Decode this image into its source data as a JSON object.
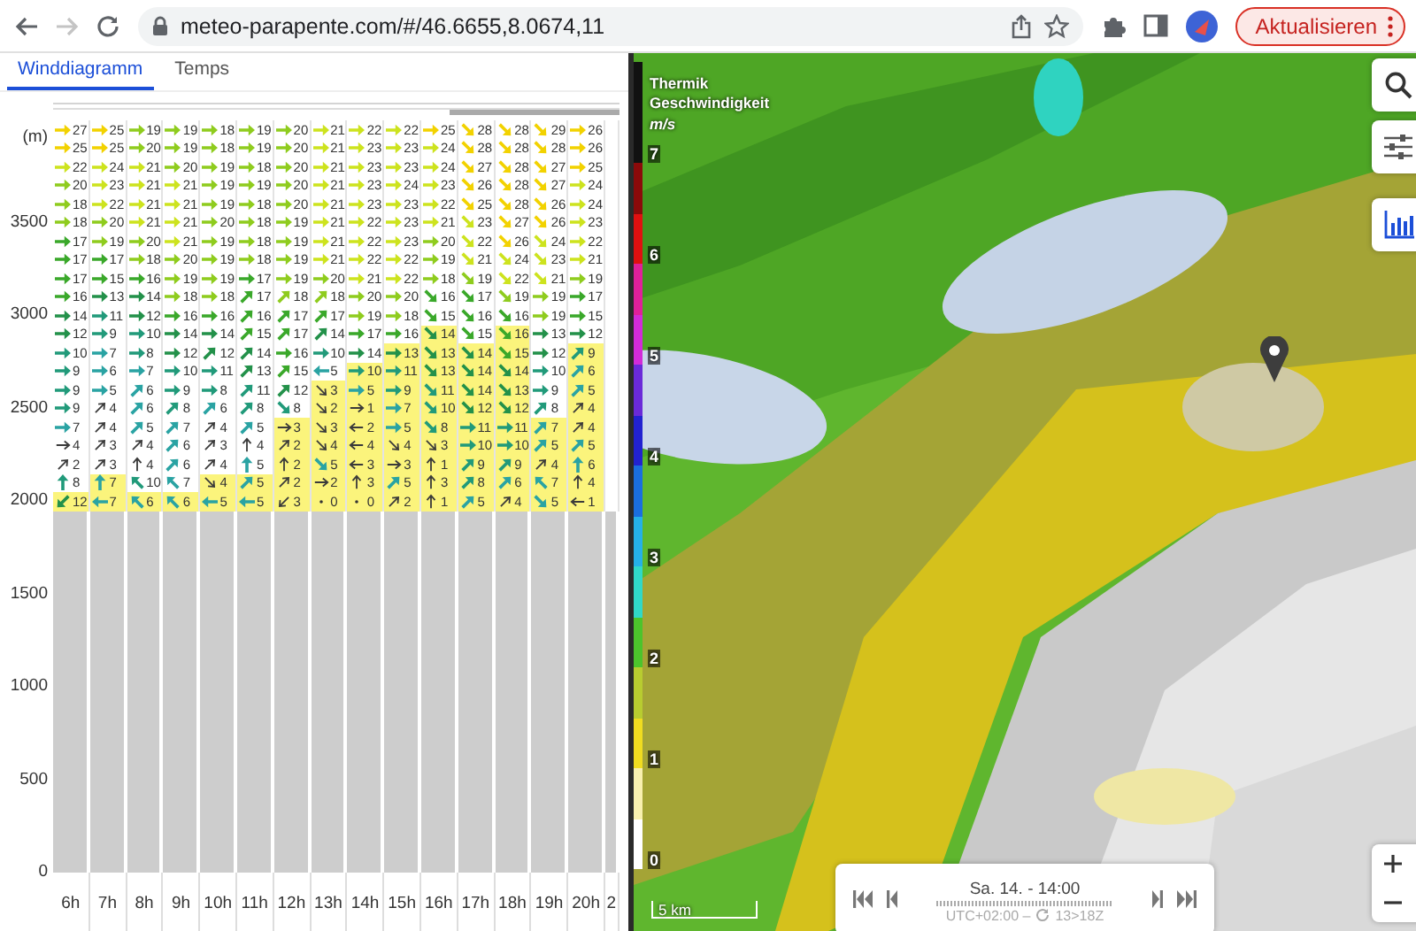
{
  "browser": {
    "url": "meteo-parapente.com/#/46.6655,8.0674,11",
    "update_button": "Aktualisieren",
    "forward_disabled": true
  },
  "tabs": [
    {
      "label": "Winddiagramm",
      "selected": true
    },
    {
      "label": "Temps",
      "selected": false
    }
  ],
  "wind_diagram": {
    "y_unit": "(m)",
    "y_ticks": [
      "3500",
      "3000",
      "2500",
      "2000",
      "1500",
      "1000",
      "500",
      "0"
    ],
    "hours": [
      "6h",
      "7h",
      "8h",
      "9h",
      "10h",
      "11h",
      "12h",
      "13h",
      "14h",
      "15h",
      "16h",
      "17h",
      "18h",
      "19h",
      "20h",
      "2"
    ],
    "rows": [
      {
        "cells": [
          {
            "speed": "27",
            "kind": "east",
            "thermal": false
          },
          {
            "speed": "25",
            "kind": "east",
            "thermal": false
          },
          {
            "speed": "19",
            "kind": "east",
            "thermal": false
          },
          {
            "speed": "19",
            "kind": "east",
            "thermal": false
          },
          {
            "speed": "18",
            "kind": "east",
            "thermal": false
          },
          {
            "speed": "19",
            "kind": "east",
            "thermal": false
          },
          {
            "speed": "20",
            "kind": "east",
            "thermal": false
          },
          {
            "speed": "21",
            "kind": "east",
            "thermal": false
          },
          {
            "speed": "22",
            "kind": "east",
            "thermal": false
          },
          {
            "speed": "22",
            "kind": "east",
            "thermal": false
          },
          {
            "speed": "25",
            "kind": "east",
            "thermal": false
          },
          {
            "speed": "28",
            "kind": "southeast",
            "thermal": false
          },
          {
            "speed": "28",
            "kind": "southeast",
            "thermal": false
          },
          {
            "speed": "29",
            "kind": "southeast",
            "thermal": false
          },
          {
            "speed": "26",
            "kind": "east",
            "thermal": false
          }
        ]
      },
      {
        "cells": [
          {
            "speed": "25",
            "kind": "east",
            "thermal": false
          },
          {
            "speed": "25",
            "kind": "east",
            "thermal": false
          },
          {
            "speed": "20",
            "kind": "east",
            "thermal": false
          },
          {
            "speed": "19",
            "kind": "east",
            "thermal": false
          },
          {
            "speed": "18",
            "kind": "east",
            "thermal": false
          },
          {
            "speed": "19",
            "kind": "east",
            "thermal": false
          },
          {
            "speed": "20",
            "kind": "east",
            "thermal": false
          },
          {
            "speed": "21",
            "kind": "east",
            "thermal": false
          },
          {
            "speed": "23",
            "kind": "east",
            "thermal": false
          },
          {
            "speed": "23",
            "kind": "east",
            "thermal": false
          },
          {
            "speed": "24",
            "kind": "east",
            "thermal": false
          },
          {
            "speed": "28",
            "kind": "southeast",
            "thermal": false
          },
          {
            "speed": "28",
            "kind": "southeast",
            "thermal": false
          },
          {
            "speed": "28",
            "kind": "southeast",
            "thermal": false
          },
          {
            "speed": "26",
            "kind": "east",
            "thermal": false
          }
        ]
      },
      {
        "cells": [
          {
            "speed": "22",
            "kind": "east",
            "thermal": false
          },
          {
            "speed": "24",
            "kind": "east",
            "thermal": false
          },
          {
            "speed": "21",
            "kind": "east",
            "thermal": false
          },
          {
            "speed": "20",
            "kind": "east",
            "thermal": false
          },
          {
            "speed": "19",
            "kind": "east",
            "thermal": false
          },
          {
            "speed": "18",
            "kind": "east",
            "thermal": false
          },
          {
            "speed": "20",
            "kind": "east",
            "thermal": false
          },
          {
            "speed": "21",
            "kind": "east",
            "thermal": false
          },
          {
            "speed": "23",
            "kind": "east",
            "thermal": false
          },
          {
            "speed": "23",
            "kind": "east",
            "thermal": false
          },
          {
            "speed": "24",
            "kind": "east",
            "thermal": false
          },
          {
            "speed": "27",
            "kind": "southeast",
            "thermal": false
          },
          {
            "speed": "28",
            "kind": "southeast",
            "thermal": false
          },
          {
            "speed": "27",
            "kind": "southeast",
            "thermal": false
          },
          {
            "speed": "25",
            "kind": "east",
            "thermal": false
          }
        ]
      },
      {
        "cells": [
          {
            "speed": "20",
            "kind": "east",
            "thermal": false
          },
          {
            "speed": "23",
            "kind": "east",
            "thermal": false
          },
          {
            "speed": "21",
            "kind": "east",
            "thermal": false
          },
          {
            "speed": "21",
            "kind": "east",
            "thermal": false
          },
          {
            "speed": "19",
            "kind": "east",
            "thermal": false
          },
          {
            "speed": "19",
            "kind": "east",
            "thermal": false
          },
          {
            "speed": "20",
            "kind": "east",
            "thermal": false
          },
          {
            "speed": "21",
            "kind": "east",
            "thermal": false
          },
          {
            "speed": "23",
            "kind": "east",
            "thermal": false
          },
          {
            "speed": "24",
            "kind": "east",
            "thermal": false
          },
          {
            "speed": "23",
            "kind": "east",
            "thermal": false
          },
          {
            "speed": "26",
            "kind": "southeast",
            "thermal": false
          },
          {
            "speed": "28",
            "kind": "southeast",
            "thermal": false
          },
          {
            "speed": "27",
            "kind": "southeast",
            "thermal": false
          },
          {
            "speed": "24",
            "kind": "east",
            "thermal": false
          }
        ]
      },
      {
        "cells": [
          {
            "speed": "18",
            "kind": "east",
            "thermal": false
          },
          {
            "speed": "22",
            "kind": "east",
            "thermal": false
          },
          {
            "speed": "21",
            "kind": "east",
            "thermal": false
          },
          {
            "speed": "21",
            "kind": "east",
            "thermal": false
          },
          {
            "speed": "19",
            "kind": "east",
            "thermal": false
          },
          {
            "speed": "18",
            "kind": "east",
            "thermal": false
          },
          {
            "speed": "20",
            "kind": "east",
            "thermal": false
          },
          {
            "speed": "21",
            "kind": "east",
            "thermal": false
          },
          {
            "speed": "23",
            "kind": "east",
            "thermal": false
          },
          {
            "speed": "23",
            "kind": "east",
            "thermal": false
          },
          {
            "speed": "22",
            "kind": "east",
            "thermal": false
          },
          {
            "speed": "25",
            "kind": "southeast",
            "thermal": false
          },
          {
            "speed": "28",
            "kind": "southeast",
            "thermal": false
          },
          {
            "speed": "26",
            "kind": "southeast",
            "thermal": false
          },
          {
            "speed": "24",
            "kind": "east",
            "thermal": false
          }
        ]
      },
      {
        "cells": [
          {
            "speed": "18",
            "kind": "east",
            "thermal": false
          },
          {
            "speed": "20",
            "kind": "east",
            "thermal": false
          },
          {
            "speed": "21",
            "kind": "east",
            "thermal": false
          },
          {
            "speed": "21",
            "kind": "east",
            "thermal": false
          },
          {
            "speed": "20",
            "kind": "east",
            "thermal": false
          },
          {
            "speed": "18",
            "kind": "east",
            "thermal": false
          },
          {
            "speed": "19",
            "kind": "east",
            "thermal": false
          },
          {
            "speed": "21",
            "kind": "east",
            "thermal": false
          },
          {
            "speed": "22",
            "kind": "east",
            "thermal": false
          },
          {
            "speed": "23",
            "kind": "east",
            "thermal": false
          },
          {
            "speed": "21",
            "kind": "east",
            "thermal": false
          },
          {
            "speed": "23",
            "kind": "southeast",
            "thermal": false
          },
          {
            "speed": "27",
            "kind": "southeast",
            "thermal": false
          },
          {
            "speed": "26",
            "kind": "southeast",
            "thermal": false
          },
          {
            "speed": "23",
            "kind": "east",
            "thermal": false
          }
        ]
      },
      {
        "cells": [
          {
            "speed": "17",
            "kind": "east",
            "thermal": false
          },
          {
            "speed": "19",
            "kind": "east",
            "thermal": false
          },
          {
            "speed": "20",
            "kind": "east",
            "thermal": false
          },
          {
            "speed": "21",
            "kind": "east",
            "thermal": false
          },
          {
            "speed": "19",
            "kind": "east",
            "thermal": false
          },
          {
            "speed": "18",
            "kind": "east",
            "thermal": false
          },
          {
            "speed": "19",
            "kind": "east",
            "thermal": false
          },
          {
            "speed": "21",
            "kind": "east",
            "thermal": false
          },
          {
            "speed": "22",
            "kind": "east",
            "thermal": false
          },
          {
            "speed": "23",
            "kind": "east",
            "thermal": false
          },
          {
            "speed": "20",
            "kind": "east",
            "thermal": false
          },
          {
            "speed": "22",
            "kind": "southeast",
            "thermal": false
          },
          {
            "speed": "26",
            "kind": "southeast",
            "thermal": false
          },
          {
            "speed": "24",
            "kind": "southeast",
            "thermal": false
          },
          {
            "speed": "22",
            "kind": "east",
            "thermal": false
          }
        ]
      },
      {
        "cells": [
          {
            "speed": "17",
            "kind": "east",
            "thermal": false
          },
          {
            "speed": "17",
            "kind": "east",
            "thermal": false
          },
          {
            "speed": "18",
            "kind": "east",
            "thermal": false
          },
          {
            "speed": "20",
            "kind": "east",
            "thermal": false
          },
          {
            "speed": "19",
            "kind": "east",
            "thermal": false
          },
          {
            "speed": "18",
            "kind": "east",
            "thermal": false
          },
          {
            "speed": "19",
            "kind": "east",
            "thermal": false
          },
          {
            "speed": "21",
            "kind": "east",
            "thermal": false
          },
          {
            "speed": "22",
            "kind": "east",
            "thermal": false
          },
          {
            "speed": "22",
            "kind": "east",
            "thermal": false
          },
          {
            "speed": "19",
            "kind": "east",
            "thermal": false
          },
          {
            "speed": "21",
            "kind": "southeast",
            "thermal": false
          },
          {
            "speed": "24",
            "kind": "southeast",
            "thermal": false
          },
          {
            "speed": "23",
            "kind": "southeast",
            "thermal": false
          },
          {
            "speed": "21",
            "kind": "east",
            "thermal": false
          }
        ]
      },
      {
        "cells": [
          {
            "speed": "17",
            "kind": "east",
            "thermal": false
          },
          {
            "speed": "15",
            "kind": "east",
            "thermal": false
          },
          {
            "speed": "16",
            "kind": "east",
            "thermal": false
          },
          {
            "speed": "19",
            "kind": "east",
            "thermal": false
          },
          {
            "speed": "19",
            "kind": "east",
            "thermal": false
          },
          {
            "speed": "17",
            "kind": "east",
            "thermal": false
          },
          {
            "speed": "19",
            "kind": "east",
            "thermal": false
          },
          {
            "speed": "20",
            "kind": "east",
            "thermal": false
          },
          {
            "speed": "21",
            "kind": "east",
            "thermal": false
          },
          {
            "speed": "22",
            "kind": "east",
            "thermal": false
          },
          {
            "speed": "18",
            "kind": "east",
            "thermal": false
          },
          {
            "speed": "19",
            "kind": "southeast",
            "thermal": false
          },
          {
            "speed": "22",
            "kind": "southeast",
            "thermal": false
          },
          {
            "speed": "21",
            "kind": "southeast",
            "thermal": false
          },
          {
            "speed": "19",
            "kind": "east",
            "thermal": false
          }
        ]
      },
      {
        "cells": [
          {
            "speed": "16",
            "kind": "east",
            "thermal": false
          },
          {
            "speed": "13",
            "kind": "east",
            "thermal": false
          },
          {
            "speed": "14",
            "kind": "east",
            "thermal": false
          },
          {
            "speed": "18",
            "kind": "east",
            "thermal": false
          },
          {
            "speed": "18",
            "kind": "east",
            "thermal": false
          },
          {
            "speed": "17",
            "kind": "northeast",
            "thermal": false
          },
          {
            "speed": "18",
            "kind": "northeast",
            "thermal": false
          },
          {
            "speed": "18",
            "kind": "northeast",
            "thermal": false
          },
          {
            "speed": "20",
            "kind": "east",
            "thermal": false
          },
          {
            "speed": "20",
            "kind": "east",
            "thermal": false
          },
          {
            "speed": "16",
            "kind": "southeast",
            "thermal": false
          },
          {
            "speed": "17",
            "kind": "southeast",
            "thermal": false
          },
          {
            "speed": "19",
            "kind": "southeast",
            "thermal": false
          },
          {
            "speed": "19",
            "kind": "east",
            "thermal": false
          },
          {
            "speed": "17",
            "kind": "east",
            "thermal": false
          }
        ]
      },
      {
        "cells": [
          {
            "speed": "14",
            "kind": "east",
            "thermal": false
          },
          {
            "speed": "11",
            "kind": "east",
            "thermal": false
          },
          {
            "speed": "12",
            "kind": "east",
            "thermal": false
          },
          {
            "speed": "16",
            "kind": "east",
            "thermal": false
          },
          {
            "speed": "16",
            "kind": "east",
            "thermal": false
          },
          {
            "speed": "16",
            "kind": "northeast",
            "thermal": false
          },
          {
            "speed": "17",
            "kind": "northeast",
            "thermal": false
          },
          {
            "speed": "17",
            "kind": "northeast",
            "thermal": false
          },
          {
            "speed": "19",
            "kind": "east",
            "thermal": false
          },
          {
            "speed": "18",
            "kind": "east",
            "thermal": false
          },
          {
            "speed": "15",
            "kind": "southeast",
            "thermal": false
          },
          {
            "speed": "16",
            "kind": "southeast",
            "thermal": false
          },
          {
            "speed": "16",
            "kind": "southeast",
            "thermal": false
          },
          {
            "speed": "19",
            "kind": "east",
            "thermal": false
          },
          {
            "speed": "15",
            "kind": "east",
            "thermal": false
          }
        ]
      },
      {
        "cells": [
          {
            "speed": "12",
            "kind": "east",
            "thermal": false
          },
          {
            "speed": "9",
            "kind": "east",
            "thermal": false
          },
          {
            "speed": "10",
            "kind": "east",
            "thermal": false
          },
          {
            "speed": "14",
            "kind": "east",
            "thermal": false
          },
          {
            "speed": "14",
            "kind": "east",
            "thermal": false
          },
          {
            "speed": "15",
            "kind": "northeast",
            "thermal": false
          },
          {
            "speed": "17",
            "kind": "northeast",
            "thermal": false
          },
          {
            "speed": "14",
            "kind": "northeast",
            "thermal": false
          },
          {
            "speed": "17",
            "kind": "east",
            "thermal": false
          },
          {
            "speed": "16",
            "kind": "east",
            "thermal": false
          },
          {
            "speed": "14",
            "kind": "southeast",
            "thermal": true
          },
          {
            "speed": "15",
            "kind": "southeast",
            "thermal": false
          },
          {
            "speed": "16",
            "kind": "southeast",
            "thermal": true
          },
          {
            "speed": "13",
            "kind": "east",
            "thermal": false
          },
          {
            "speed": "12",
            "kind": "east",
            "thermal": false
          }
        ]
      },
      {
        "cells": [
          {
            "speed": "10",
            "kind": "east",
            "thermal": false
          },
          {
            "speed": "7",
            "kind": "east",
            "thermal": false
          },
          {
            "speed": "8",
            "kind": "east",
            "thermal": false
          },
          {
            "speed": "12",
            "kind": "east",
            "thermal": false
          },
          {
            "speed": "12",
            "kind": "northeast",
            "thermal": false
          },
          {
            "speed": "14",
            "kind": "northeast",
            "thermal": false
          },
          {
            "speed": "16",
            "kind": "east",
            "thermal": false
          },
          {
            "speed": "10",
            "kind": "east",
            "thermal": false
          },
          {
            "speed": "14",
            "kind": "east",
            "thermal": false
          },
          {
            "speed": "13",
            "kind": "east",
            "thermal": true
          },
          {
            "speed": "13",
            "kind": "southeast",
            "thermal": true
          },
          {
            "speed": "14",
            "kind": "southeast",
            "thermal": true
          },
          {
            "speed": "15",
            "kind": "southeast",
            "thermal": true
          },
          {
            "speed": "12",
            "kind": "east",
            "thermal": false
          },
          {
            "speed": "9",
            "kind": "northeast",
            "thermal": true
          }
        ]
      },
      {
        "cells": [
          {
            "speed": "9",
            "kind": "east",
            "thermal": false
          },
          {
            "speed": "6",
            "kind": "east",
            "thermal": false
          },
          {
            "speed": "7",
            "kind": "east",
            "thermal": false
          },
          {
            "speed": "10",
            "kind": "east",
            "thermal": false
          },
          {
            "speed": "11",
            "kind": "east",
            "thermal": false
          },
          {
            "speed": "13",
            "kind": "northeast",
            "thermal": false
          },
          {
            "speed": "15",
            "kind": "northeast",
            "thermal": false
          },
          {
            "speed": "5",
            "kind": "west",
            "thermal": false
          },
          {
            "speed": "10",
            "kind": "east",
            "thermal": true
          },
          {
            "speed": "11",
            "kind": "east",
            "thermal": true
          },
          {
            "speed": "13",
            "kind": "southeast",
            "thermal": true
          },
          {
            "speed": "14",
            "kind": "southeast",
            "thermal": true
          },
          {
            "speed": "14",
            "kind": "southeast",
            "thermal": true
          },
          {
            "speed": "10",
            "kind": "east",
            "thermal": false
          },
          {
            "speed": "6",
            "kind": "northeast",
            "thermal": true
          }
        ]
      },
      {
        "cells": [
          {
            "speed": "9",
            "kind": "east",
            "thermal": false
          },
          {
            "speed": "5",
            "kind": "east",
            "thermal": false
          },
          {
            "speed": "6",
            "kind": "northeast",
            "thermal": false
          },
          {
            "speed": "9",
            "kind": "east",
            "thermal": false
          },
          {
            "speed": "8",
            "kind": "east",
            "thermal": false
          },
          {
            "speed": "11",
            "kind": "northeast",
            "thermal": false
          },
          {
            "speed": "12",
            "kind": "northeast",
            "thermal": false
          },
          {
            "speed": "3",
            "kind": "southeast",
            "thermal": true
          },
          {
            "speed": "5",
            "kind": "east",
            "thermal": true
          },
          {
            "speed": "9",
            "kind": "east",
            "thermal": true
          },
          {
            "speed": "11",
            "kind": "southeast",
            "thermal": true
          },
          {
            "speed": "14",
            "kind": "southeast",
            "thermal": true
          },
          {
            "speed": "13",
            "kind": "southeast",
            "thermal": true
          },
          {
            "speed": "9",
            "kind": "east",
            "thermal": false
          },
          {
            "speed": "5",
            "kind": "northeast",
            "thermal": true
          }
        ]
      },
      {
        "cells": [
          {
            "speed": "9",
            "kind": "east",
            "thermal": false
          },
          {
            "speed": "4",
            "kind": "northeast",
            "thermal": false
          },
          {
            "speed": "6",
            "kind": "northeast",
            "thermal": false
          },
          {
            "speed": "8",
            "kind": "northeast",
            "thermal": false
          },
          {
            "speed": "6",
            "kind": "northeast",
            "thermal": false
          },
          {
            "speed": "8",
            "kind": "northeast",
            "thermal": false
          },
          {
            "speed": "8",
            "kind": "southeast",
            "thermal": false
          },
          {
            "speed": "2",
            "kind": "southeast",
            "thermal": true
          },
          {
            "speed": "1",
            "kind": "east",
            "thermal": true
          },
          {
            "speed": "7",
            "kind": "east",
            "thermal": true
          },
          {
            "speed": "10",
            "kind": "southeast",
            "thermal": true
          },
          {
            "speed": "12",
            "kind": "southeast",
            "thermal": true
          },
          {
            "speed": "12",
            "kind": "southeast",
            "thermal": true
          },
          {
            "speed": "8",
            "kind": "northeast",
            "thermal": false
          },
          {
            "speed": "4",
            "kind": "northeast",
            "thermal": true
          }
        ]
      },
      {
        "cells": [
          {
            "speed": "7",
            "kind": "east",
            "thermal": false
          },
          {
            "speed": "4",
            "kind": "northeast",
            "thermal": false
          },
          {
            "speed": "5",
            "kind": "northeast",
            "thermal": false
          },
          {
            "speed": "7",
            "kind": "northeast",
            "thermal": false
          },
          {
            "speed": "4",
            "kind": "northeast",
            "thermal": false
          },
          {
            "speed": "5",
            "kind": "northeast",
            "thermal": false
          },
          {
            "speed": "3",
            "kind": "east",
            "thermal": true
          },
          {
            "speed": "3",
            "kind": "southeast",
            "thermal": true
          },
          {
            "speed": "2",
            "kind": "west",
            "thermal": true
          },
          {
            "speed": "5",
            "kind": "east",
            "thermal": true
          },
          {
            "speed": "8",
            "kind": "southeast",
            "thermal": true
          },
          {
            "speed": "11",
            "kind": "east",
            "thermal": true
          },
          {
            "speed": "11",
            "kind": "east",
            "thermal": true
          },
          {
            "speed": "7",
            "kind": "northeast",
            "thermal": true
          },
          {
            "speed": "4",
            "kind": "northeast",
            "thermal": true
          }
        ]
      },
      {
        "cells": [
          {
            "speed": "4",
            "kind": "east",
            "thermal": false
          },
          {
            "speed": "3",
            "kind": "northeast",
            "thermal": false
          },
          {
            "speed": "4",
            "kind": "northeast",
            "thermal": false
          },
          {
            "speed": "6",
            "kind": "northeast",
            "thermal": false
          },
          {
            "speed": "3",
            "kind": "northeast",
            "thermal": false
          },
          {
            "speed": "4",
            "kind": "north",
            "thermal": false
          },
          {
            "speed": "2",
            "kind": "northeast",
            "thermal": true
          },
          {
            "speed": "4",
            "kind": "southeast",
            "thermal": true
          },
          {
            "speed": "4",
            "kind": "west",
            "thermal": true
          },
          {
            "speed": "4",
            "kind": "southeast",
            "thermal": true
          },
          {
            "speed": "3",
            "kind": "southeast",
            "thermal": true
          },
          {
            "speed": "10",
            "kind": "east",
            "thermal": true
          },
          {
            "speed": "10",
            "kind": "east",
            "thermal": true
          },
          {
            "speed": "5",
            "kind": "northeast",
            "thermal": true
          },
          {
            "speed": "5",
            "kind": "northeast",
            "thermal": true
          }
        ]
      },
      {
        "cells": [
          {
            "speed": "2",
            "kind": "northeast",
            "thermal": false
          },
          {
            "speed": "3",
            "kind": "northeast",
            "thermal": false
          },
          {
            "speed": "4",
            "kind": "north",
            "thermal": false
          },
          {
            "speed": "6",
            "kind": "northeast",
            "thermal": false
          },
          {
            "speed": "4",
            "kind": "northeast",
            "thermal": false
          },
          {
            "speed": "5",
            "kind": "north",
            "thermal": false
          },
          {
            "speed": "2",
            "kind": "north",
            "thermal": true
          },
          {
            "speed": "5",
            "kind": "southeast",
            "thermal": true
          },
          {
            "speed": "3",
            "kind": "west",
            "thermal": true
          },
          {
            "speed": "3",
            "kind": "east",
            "thermal": true
          },
          {
            "speed": "1",
            "kind": "north",
            "thermal": true
          },
          {
            "speed": "9",
            "kind": "northeast",
            "thermal": true
          },
          {
            "speed": "9",
            "kind": "northeast",
            "thermal": true
          },
          {
            "speed": "4",
            "kind": "northeast",
            "thermal": true
          },
          {
            "speed": "6",
            "kind": "north",
            "thermal": true
          }
        ]
      },
      {
        "cells": [
          {
            "speed": "8",
            "kind": "north",
            "thermal": false
          },
          {
            "speed": "7",
            "kind": "north",
            "thermal": true
          },
          {
            "speed": "10",
            "kind": "northwest",
            "thermal": false
          },
          {
            "speed": "7",
            "kind": "northwest",
            "thermal": false
          },
          {
            "speed": "4",
            "kind": "southeast",
            "thermal": true
          },
          {
            "speed": "5",
            "kind": "northeast",
            "thermal": true
          },
          {
            "speed": "2",
            "kind": "northeast",
            "thermal": true
          },
          {
            "speed": "2",
            "kind": "east",
            "thermal": true
          },
          {
            "speed": "3",
            "kind": "north",
            "thermal": true
          },
          {
            "speed": "5",
            "kind": "northeast",
            "thermal": true
          },
          {
            "speed": "3",
            "kind": "north",
            "thermal": true
          },
          {
            "speed": "8",
            "kind": "northeast",
            "thermal": true
          },
          {
            "speed": "6",
            "kind": "northeast",
            "thermal": true
          },
          {
            "speed": "7",
            "kind": "northwest",
            "thermal": true
          },
          {
            "speed": "4",
            "kind": "north",
            "thermal": true
          }
        ]
      },
      {
        "cells": [
          {
            "speed": "12",
            "kind": "southwest",
            "thermal": true
          },
          {
            "speed": "7",
            "kind": "west",
            "thermal": true
          },
          {
            "speed": "6",
            "kind": "northwest",
            "thermal": true
          },
          {
            "speed": "6",
            "kind": "northwest",
            "thermal": true
          },
          {
            "speed": "5",
            "kind": "west",
            "thermal": true
          },
          {
            "speed": "5",
            "kind": "west",
            "thermal": true
          },
          {
            "speed": "3",
            "kind": "southwest",
            "thermal": true
          },
          {
            "speed": "0",
            "kind": "calm",
            "thermal": true
          },
          {
            "speed": "0",
            "kind": "calm",
            "thermal": true
          },
          {
            "speed": "2",
            "kind": "northeast",
            "thermal": true
          },
          {
            "speed": "1",
            "kind": "north",
            "thermal": true
          },
          {
            "speed": "5",
            "kind": "northeast",
            "thermal": true
          },
          {
            "speed": "4",
            "kind": "northeast",
            "thermal": true
          },
          {
            "speed": "5",
            "kind": "southeast",
            "thermal": true
          },
          {
            "speed": "1",
            "kind": "west",
            "thermal": true
          }
        ]
      }
    ]
  },
  "map": {
    "legend": {
      "title": "Thermik Geschwindigkeit",
      "unit": "m/s",
      "scale": [
        {
          "color": "#111111"
        },
        {
          "color": "#111111"
        },
        {
          "color": "#8b0a0a"
        },
        {
          "color": "#e01010"
        },
        {
          "color": "#e0209a"
        },
        {
          "color": "#d22bd8"
        },
        {
          "color": "#6a2ad8"
        },
        {
          "color": "#2222d0"
        },
        {
          "color": "#1a6ee0"
        },
        {
          "color": "#25b0e8"
        },
        {
          "color": "#30d8c8"
        },
        {
          "color": "#4cc42c"
        },
        {
          "color": "#b8cc30"
        },
        {
          "color": "#f0dc20"
        },
        {
          "color": "#f8f0b0"
        },
        {
          "color": "#ffffff"
        }
      ],
      "labels": [
        "7",
        "6",
        "5",
        "4",
        "3",
        "2",
        "1",
        "0"
      ]
    },
    "scale_bar": "5 km",
    "timeline": {
      "date": "Sa. 14. - 14:00",
      "timezone": "UTC+02:00 –",
      "run": "13>18Z"
    }
  }
}
